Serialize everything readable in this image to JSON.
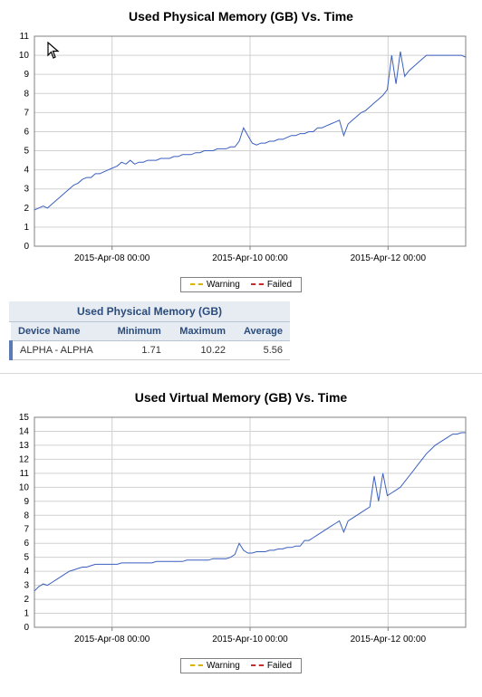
{
  "legend": {
    "warning": "Warning",
    "failed": "Failed"
  },
  "chart_data": [
    {
      "type": "line",
      "title": "Used Physical Memory (GB) Vs. Time",
      "xlabel": "",
      "ylabel": "",
      "ylim": [
        0,
        11
      ],
      "yticks": [
        0,
        1,
        2,
        3,
        4,
        5,
        6,
        7,
        8,
        9,
        10,
        11
      ],
      "xticks": [
        "2015-Apr-08 00:00",
        "2015-Apr-10 00:00",
        "2015-Apr-12 00:00"
      ],
      "x": [
        0,
        1,
        2,
        3,
        4,
        5,
        6,
        7,
        8,
        9,
        10,
        11,
        12,
        13,
        14,
        15,
        16,
        17,
        18,
        19,
        20,
        21,
        22,
        23,
        24,
        25,
        26,
        27,
        28,
        29,
        30,
        31,
        32,
        33,
        34,
        35,
        36,
        37,
        38,
        39,
        40,
        41,
        42,
        43,
        44,
        45,
        46,
        47,
        48,
        49,
        50,
        51,
        52,
        53,
        54,
        55,
        56,
        57,
        58,
        59,
        60,
        61,
        62,
        63,
        64,
        65,
        66,
        67,
        68,
        69,
        70,
        71,
        72,
        73,
        74,
        75,
        76,
        77,
        78,
        79,
        80,
        81,
        82,
        83,
        84,
        85,
        86,
        87,
        88,
        89,
        90,
        91,
        92,
        93,
        94,
        95,
        96,
        97,
        98,
        99
      ],
      "series": [
        {
          "name": "Used Physical Memory (GB)",
          "values": [
            1.9,
            2.0,
            2.1,
            2.0,
            2.2,
            2.4,
            2.6,
            2.8,
            3.0,
            3.2,
            3.3,
            3.5,
            3.6,
            3.6,
            3.8,
            3.8,
            3.9,
            4.0,
            4.1,
            4.2,
            4.4,
            4.3,
            4.5,
            4.3,
            4.4,
            4.4,
            4.5,
            4.5,
            4.5,
            4.6,
            4.6,
            4.6,
            4.7,
            4.7,
            4.8,
            4.8,
            4.8,
            4.9,
            4.9,
            5.0,
            5.0,
            5.0,
            5.1,
            5.1,
            5.1,
            5.2,
            5.2,
            5.5,
            6.2,
            5.8,
            5.4,
            5.3,
            5.4,
            5.4,
            5.5,
            5.5,
            5.6,
            5.6,
            5.7,
            5.8,
            5.8,
            5.9,
            5.9,
            6.0,
            6.0,
            6.2,
            6.2,
            6.3,
            6.4,
            6.5,
            6.6,
            5.8,
            6.4,
            6.6,
            6.8,
            7.0,
            7.1,
            7.3,
            7.5,
            7.7,
            7.9,
            8.2,
            10.0,
            8.5,
            10.2,
            8.9,
            9.2,
            9.4,
            9.6,
            9.8,
            10.0,
            10.0,
            10.0,
            10.0,
            10.0,
            10.0,
            10.0,
            10.0,
            10.0,
            9.9
          ]
        }
      ],
      "legend_series": [
        "Warning",
        "Failed"
      ]
    },
    {
      "type": "line",
      "title": "Used Virtual Memory (GB) Vs. Time",
      "xlabel": "",
      "ylabel": "",
      "ylim": [
        0,
        15
      ],
      "yticks": [
        0,
        1,
        2,
        3,
        4,
        5,
        6,
        7,
        8,
        9,
        10,
        11,
        12,
        13,
        14,
        15
      ],
      "xticks": [
        "2015-Apr-08 00:00",
        "2015-Apr-10 00:00",
        "2015-Apr-12 00:00"
      ],
      "x": [
        0,
        1,
        2,
        3,
        4,
        5,
        6,
        7,
        8,
        9,
        10,
        11,
        12,
        13,
        14,
        15,
        16,
        17,
        18,
        19,
        20,
        21,
        22,
        23,
        24,
        25,
        26,
        27,
        28,
        29,
        30,
        31,
        32,
        33,
        34,
        35,
        36,
        37,
        38,
        39,
        40,
        41,
        42,
        43,
        44,
        45,
        46,
        47,
        48,
        49,
        50,
        51,
        52,
        53,
        54,
        55,
        56,
        57,
        58,
        59,
        60,
        61,
        62,
        63,
        64,
        65,
        66,
        67,
        68,
        69,
        70,
        71,
        72,
        73,
        74,
        75,
        76,
        77,
        78,
        79,
        80,
        81,
        82,
        83,
        84,
        85,
        86,
        87,
        88,
        89,
        90,
        91,
        92,
        93,
        94,
        95,
        96,
        97,
        98,
        99
      ],
      "series": [
        {
          "name": "Used Virtual Memory (GB)",
          "values": [
            2.6,
            2.9,
            3.1,
            3.0,
            3.2,
            3.4,
            3.6,
            3.8,
            4.0,
            4.1,
            4.2,
            4.3,
            4.3,
            4.4,
            4.5,
            4.5,
            4.5,
            4.5,
            4.5,
            4.5,
            4.6,
            4.6,
            4.6,
            4.6,
            4.6,
            4.6,
            4.6,
            4.6,
            4.7,
            4.7,
            4.7,
            4.7,
            4.7,
            4.7,
            4.7,
            4.8,
            4.8,
            4.8,
            4.8,
            4.8,
            4.8,
            4.9,
            4.9,
            4.9,
            4.9,
            5.0,
            5.2,
            6.0,
            5.5,
            5.3,
            5.3,
            5.4,
            5.4,
            5.4,
            5.5,
            5.5,
            5.6,
            5.6,
            5.7,
            5.7,
            5.8,
            5.8,
            6.2,
            6.2,
            6.4,
            6.6,
            6.8,
            7.0,
            7.2,
            7.4,
            7.6,
            6.8,
            7.6,
            7.8,
            8.0,
            8.2,
            8.4,
            8.6,
            10.8,
            9.0,
            11.0,
            9.4,
            9.6,
            9.8,
            10.0,
            10.4,
            10.8,
            11.2,
            11.6,
            12.0,
            12.4,
            12.7,
            13.0,
            13.2,
            13.4,
            13.6,
            13.8,
            13.8,
            13.9,
            13.9
          ]
        }
      ],
      "legend_series": [
        "Warning",
        "Failed"
      ]
    }
  ],
  "table": {
    "title": "Used Physical Memory (GB)",
    "columns": [
      "Device Name",
      "Minimum",
      "Maximum",
      "Average"
    ],
    "rows": [
      {
        "device": "ALPHA - ALPHA",
        "min": "1.71",
        "max": "10.22",
        "avg": "5.56"
      }
    ]
  }
}
